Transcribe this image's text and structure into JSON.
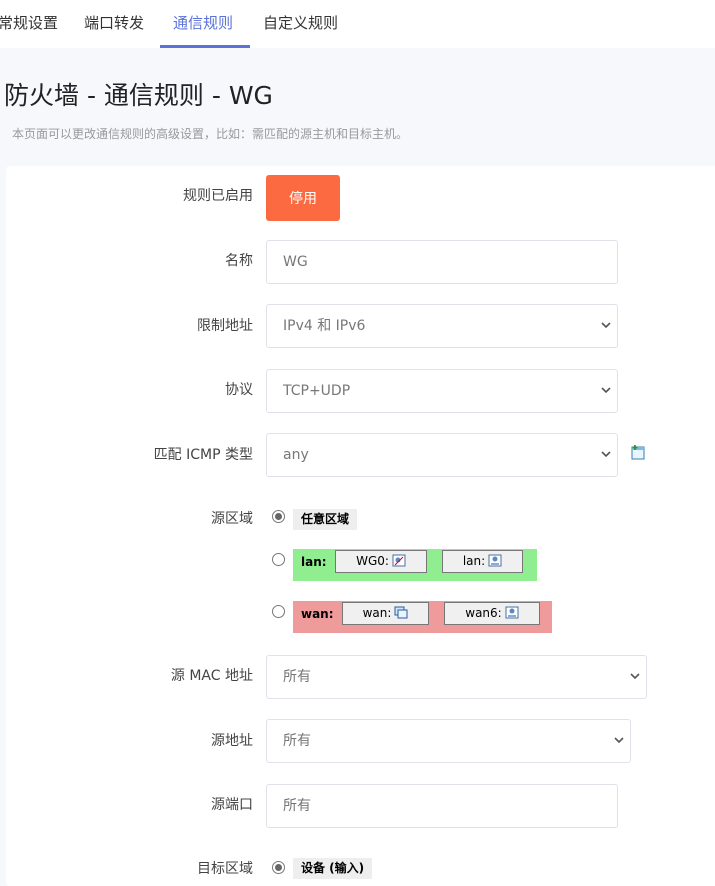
{
  "tabs": [
    {
      "label": "常规设置"
    },
    {
      "label": "端口转发"
    },
    {
      "label": "通信规则"
    },
    {
      "label": "自定义规则"
    }
  ],
  "page": {
    "title": "防火墙 - 通信规则 - WG",
    "description": "本页面可以更改通信规则的高级设置，比如：需匹配的源主机和目标主机。"
  },
  "form": {
    "enabled": {
      "label": "规则已启用",
      "button": "停用"
    },
    "name": {
      "label": "名称",
      "value": "WG"
    },
    "family": {
      "label": "限制地址",
      "value": "IPv4 和 IPv6"
    },
    "protocol": {
      "label": "协议",
      "value": "TCP+UDP"
    },
    "icmp": {
      "label": "匹配 ICMP 类型",
      "value": "any"
    },
    "src_zone": {
      "label": "源区域",
      "any": "任意区域",
      "lan": {
        "name": "lan:",
        "networks": [
          "WG0:",
          "lan:"
        ]
      },
      "wan": {
        "name": "wan:",
        "networks": [
          "wan:",
          "wan6:"
        ]
      }
    },
    "src_mac": {
      "label": "源 MAC 地址",
      "value": "所有"
    },
    "src_ip": {
      "label": "源地址",
      "value": "所有"
    },
    "src_port": {
      "label": "源端口",
      "placeholder": "所有"
    },
    "dest_zone": {
      "label": "目标区域",
      "value": "设备 (输入)"
    }
  },
  "colors": {
    "accent": "#5b72d9",
    "disable_button": "#fb6a40",
    "lan_zone": "#90ee90",
    "wan_zone": "#f09b9b"
  }
}
